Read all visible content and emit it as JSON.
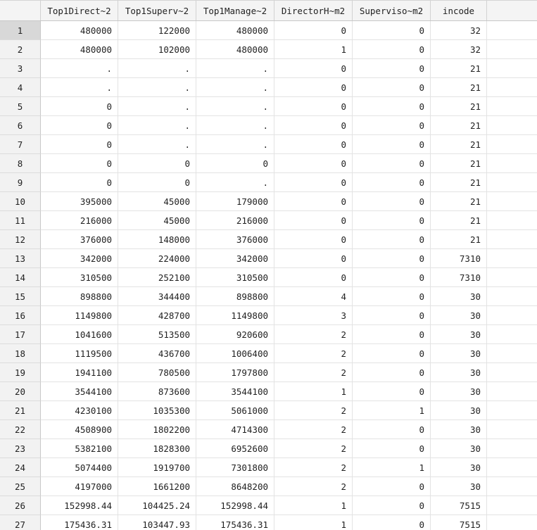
{
  "table": {
    "columns": [
      "Top1Direct~2",
      "Top1Superv~2",
      "Top1Manage~2",
      "DirectorH~m2",
      "Superviso~m2",
      "incode"
    ],
    "active_row": 1,
    "rows": [
      {
        "n": "1",
        "cells": [
          "480000",
          "122000",
          "480000",
          "0",
          "0",
          "32"
        ]
      },
      {
        "n": "2",
        "cells": [
          "480000",
          "102000",
          "480000",
          "1",
          "0",
          "32"
        ]
      },
      {
        "n": "3",
        "cells": [
          ".",
          ".",
          ".",
          "0",
          "0",
          "21"
        ]
      },
      {
        "n": "4",
        "cells": [
          ".",
          ".",
          ".",
          "0",
          "0",
          "21"
        ]
      },
      {
        "n": "5",
        "cells": [
          "0",
          ".",
          ".",
          "0",
          "0",
          "21"
        ]
      },
      {
        "n": "6",
        "cells": [
          "0",
          ".",
          ".",
          "0",
          "0",
          "21"
        ]
      },
      {
        "n": "7",
        "cells": [
          "0",
          ".",
          ".",
          "0",
          "0",
          "21"
        ]
      },
      {
        "n": "8",
        "cells": [
          "0",
          "0",
          "0",
          "0",
          "0",
          "21"
        ]
      },
      {
        "n": "9",
        "cells": [
          "0",
          "0",
          ".",
          "0",
          "0",
          "21"
        ]
      },
      {
        "n": "10",
        "cells": [
          "395000",
          "45000",
          "179000",
          "0",
          "0",
          "21"
        ]
      },
      {
        "n": "11",
        "cells": [
          "216000",
          "45000",
          "216000",
          "0",
          "0",
          "21"
        ]
      },
      {
        "n": "12",
        "cells": [
          "376000",
          "148000",
          "376000",
          "0",
          "0",
          "21"
        ]
      },
      {
        "n": "13",
        "cells": [
          "342000",
          "224000",
          "342000",
          "0",
          "0",
          "7310"
        ]
      },
      {
        "n": "14",
        "cells": [
          "310500",
          "252100",
          "310500",
          "0",
          "0",
          "7310"
        ]
      },
      {
        "n": "15",
        "cells": [
          "898800",
          "344400",
          "898800",
          "4",
          "0",
          "30"
        ]
      },
      {
        "n": "16",
        "cells": [
          "1149800",
          "428700",
          "1149800",
          "3",
          "0",
          "30"
        ]
      },
      {
        "n": "17",
        "cells": [
          "1041600",
          "513500",
          "920600",
          "2",
          "0",
          "30"
        ]
      },
      {
        "n": "18",
        "cells": [
          "1119500",
          "436700",
          "1006400",
          "2",
          "0",
          "30"
        ]
      },
      {
        "n": "19",
        "cells": [
          "1941100",
          "780500",
          "1797800",
          "2",
          "0",
          "30"
        ]
      },
      {
        "n": "20",
        "cells": [
          "3544100",
          "873600",
          "3544100",
          "1",
          "0",
          "30"
        ]
      },
      {
        "n": "21",
        "cells": [
          "4230100",
          "1035300",
          "5061000",
          "2",
          "1",
          "30"
        ]
      },
      {
        "n": "22",
        "cells": [
          "4508900",
          "1802200",
          "4714300",
          "2",
          "0",
          "30"
        ]
      },
      {
        "n": "23",
        "cells": [
          "5382100",
          "1828300",
          "6952600",
          "2",
          "0",
          "30"
        ]
      },
      {
        "n": "24",
        "cells": [
          "5074400",
          "1919700",
          "7301800",
          "2",
          "1",
          "30"
        ]
      },
      {
        "n": "25",
        "cells": [
          "4197000",
          "1661200",
          "8648200",
          "2",
          "0",
          "30"
        ]
      },
      {
        "n": "26",
        "cells": [
          "152998.44",
          "104425.24",
          "152998.44",
          "1",
          "0",
          "7515"
        ]
      },
      {
        "n": "27",
        "cells": [
          "175436.31",
          "103447.93",
          "175436.31",
          "1",
          "0",
          "7515"
        ]
      }
    ]
  }
}
